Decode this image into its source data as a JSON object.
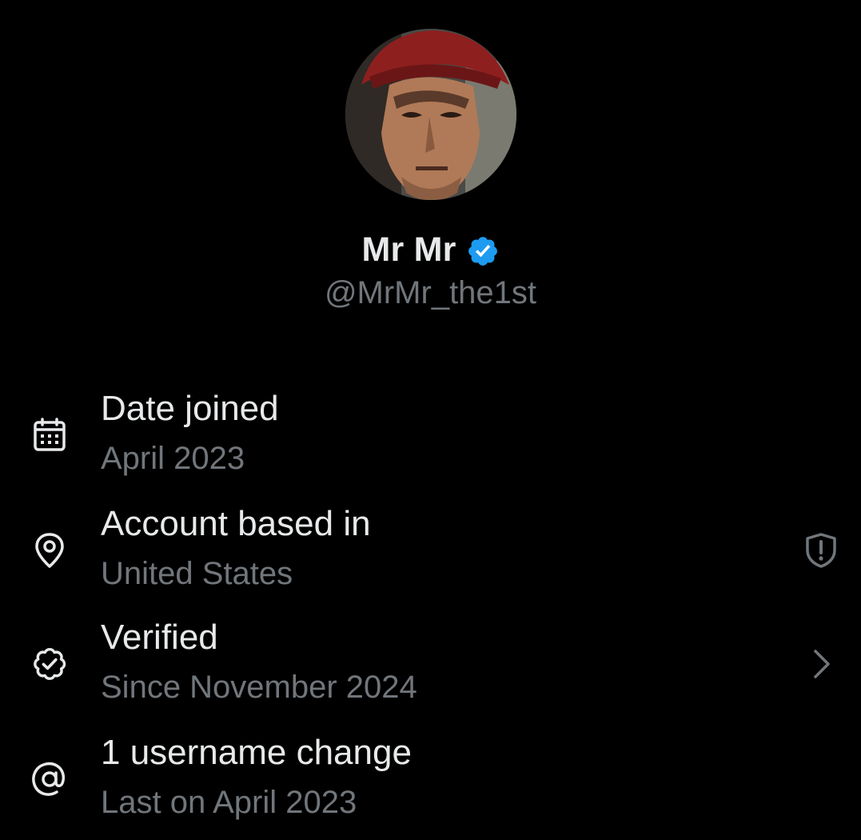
{
  "profile": {
    "display_name": "Mr Mr",
    "handle": "@MrMr_the1st",
    "verified": true,
    "badge_color": "#1d9bf0"
  },
  "about": {
    "rows": [
      {
        "icon": "calendar-icon",
        "title": "Date joined",
        "subtitle": "April 2023"
      },
      {
        "icon": "location-pin-icon",
        "title": "Account based in",
        "subtitle": "United States",
        "right_icon": "shield-alert-icon"
      },
      {
        "icon": "verified-badge-icon",
        "title": "Verified",
        "subtitle": "Since November 2024",
        "right_icon": "chevron-right-icon"
      },
      {
        "icon": "at-sign-icon",
        "title": "1 username change",
        "subtitle": "Last on April 2023"
      }
    ]
  },
  "colors": {
    "background": "#000000",
    "primary_text": "#e7e9ea",
    "secondary_text": "#71767b",
    "accent": "#1d9bf0"
  }
}
